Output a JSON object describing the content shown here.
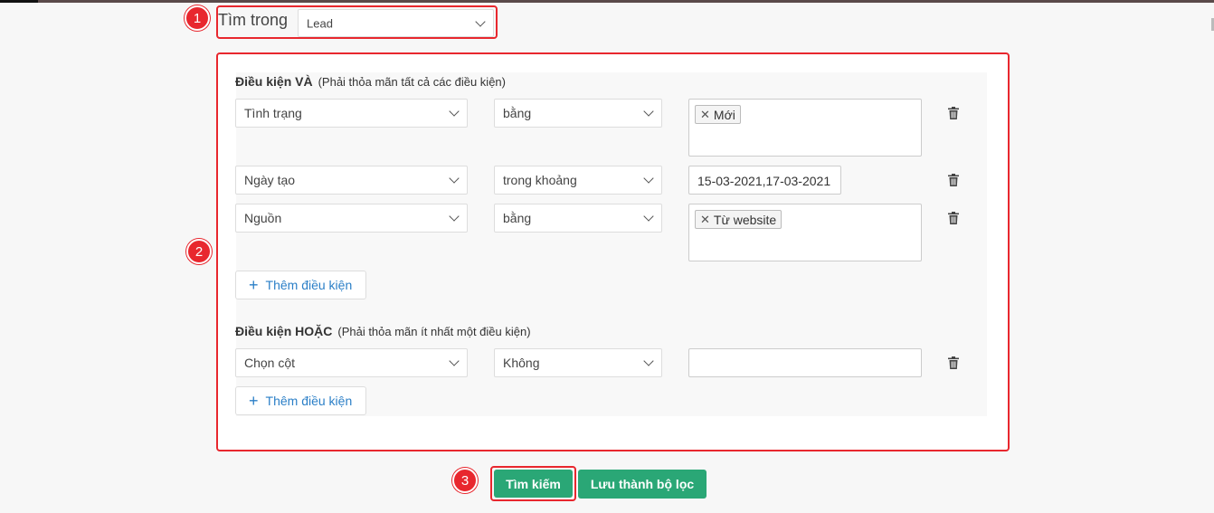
{
  "badges": [
    "1",
    "2",
    "3"
  ],
  "search_in": {
    "label": "Tìm trong",
    "value": "Lead"
  },
  "and_section": {
    "title": "Điều kiện VÀ",
    "hint": "(Phải thỏa mãn tất cả các điều kiện)",
    "rows": [
      {
        "field": "Tình trạng",
        "operator": "bằng",
        "chip": "Mới"
      },
      {
        "field": "Ngày tạo",
        "operator": "trong khoảng",
        "text": "15-03-2021,17-03-2021"
      },
      {
        "field": "Nguồn",
        "operator": "bằng",
        "chip": "Từ website"
      }
    ],
    "add_label": "Thêm điều kiện"
  },
  "or_section": {
    "title": "Điều kiện HOẶC",
    "hint": "(Phải thỏa mãn ít nhất một điều kiện)",
    "rows": [
      {
        "field": "Chọn cột",
        "operator": "Không",
        "text": ""
      }
    ],
    "add_label": "Thêm điều kiện"
  },
  "actions": {
    "search": "Tìm kiếm",
    "save_filter": "Lưu thành bộ lọc"
  },
  "colors": {
    "accent_red": "#e8272e",
    "green": "#2aa776",
    "link_blue": "#2b7fc7"
  },
  "icons": {
    "trash": "trash-icon",
    "chevron": "chevron-down-icon",
    "plus": "plus-icon",
    "remove": "close-icon"
  }
}
